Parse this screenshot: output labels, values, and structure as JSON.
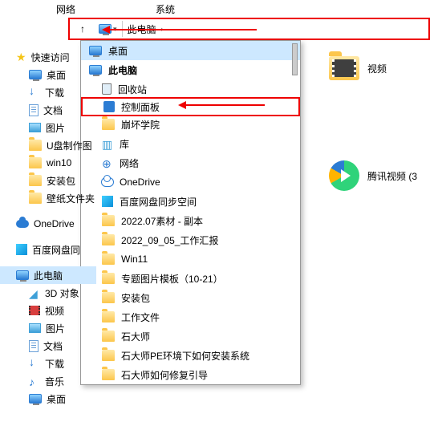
{
  "tabs": {
    "network": "网络",
    "system": "系统"
  },
  "breadcrumb": {
    "this_pc": "此电脑"
  },
  "dropdown": {
    "desktop": "桌面",
    "this_pc": "此电脑",
    "recycle": "回收站",
    "control_panel": "控制面板",
    "school": "崩坏学院",
    "library": "库",
    "network": "网络",
    "onedrive": "OneDrive",
    "baidu": "百度网盘同步空间",
    "f1": "2022.07素材 - 副本",
    "f2": "2022_09_05_工作汇报",
    "f3": "Win11",
    "f4": "专题图片模板（10-21）",
    "f5": "安装包",
    "f6": "工作文件",
    "f7": "石大师",
    "f8": "石大师PE环境下如何安装系统",
    "f9": "石大师如何修复引导"
  },
  "sidebar": {
    "quick": "快速访问",
    "desktop": "桌面",
    "downloads": "下载",
    "documents": "文档",
    "pictures": "图片",
    "usb": "U盘制作图",
    "win10": "win10",
    "pkg": "安装包",
    "wallpaper": "壁纸文件夹",
    "onedrive": "OneDrive",
    "baidu": "百度网盘同",
    "this_pc": "此电脑",
    "obj3d": "3D 对象",
    "video": "视频",
    "pictures2": "图片",
    "documents2": "文档",
    "downloads2": "下载",
    "music": "音乐",
    "desktop2": "桌面"
  },
  "content": {
    "video": "视频",
    "tencent": "腾讯视频 (3"
  }
}
